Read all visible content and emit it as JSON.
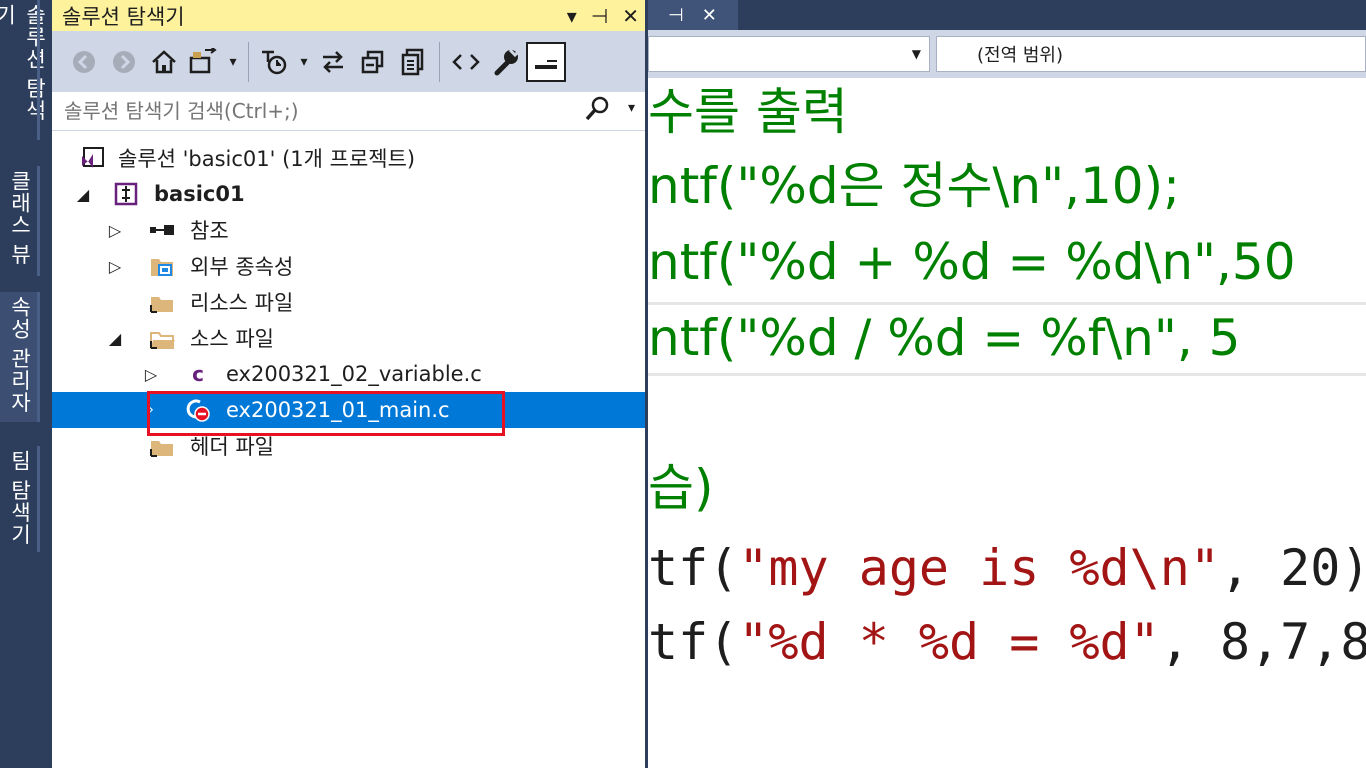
{
  "side_tabs": [
    {
      "label": "솔루션 탐색기",
      "active": false
    },
    {
      "label": "클래스 뷰",
      "active": false
    },
    {
      "label": "속성 관리자",
      "active": true
    },
    {
      "label": "팀 탐색기",
      "active": false
    }
  ],
  "panel": {
    "title": "솔루션 탐색기",
    "controls": {
      "dropdown": "▾",
      "pin": "⊣",
      "close": "✕"
    },
    "search_placeholder": "솔루션 탐색기 검색(Ctrl+;)"
  },
  "tree": {
    "solution": "솔루션 'basic01' (1개 프로젝트)",
    "project": "basic01",
    "items": [
      {
        "label": "참조",
        "icon": "references-icon"
      },
      {
        "label": "외부 종속성",
        "icon": "external-dependencies-icon"
      },
      {
        "label": "리소스 파일",
        "icon": "folder-icon"
      },
      {
        "label": "소스 파일",
        "icon": "folder-open-icon"
      },
      {
        "label": "ex200321_02_variable.c",
        "icon": "c-file-icon"
      },
      {
        "label": "ex200321_01_main.c",
        "icon": "c-file-excluded-icon",
        "selected": true
      },
      {
        "label": "헤더 파일",
        "icon": "folder-icon"
      }
    ]
  },
  "editor": {
    "tab_pin": "⊣",
    "tab_close": "✕",
    "scope_dropdown": "(전역 범위)",
    "lines": [
      {
        "parts": [
          {
            "t": "수를 출력",
            "c": "cmt"
          }
        ]
      },
      {
        "parts": [
          {
            "t": "ntf(\"%d은 정수\\n\",10);",
            "c": "cmt"
          }
        ]
      },
      {
        "parts": [
          {
            "t": "ntf(\"%d + %d = %d\\n\",50",
            "c": "cmt"
          }
        ]
      },
      {
        "parts": [
          {
            "t": "ntf(\"%d / %d = %f\\n\", 5",
            "c": "cmt"
          }
        ]
      },
      {
        "parts": [
          {
            "t": "",
            "c": "blk"
          }
        ]
      },
      {
        "parts": [
          {
            "t": "습)",
            "c": "cmt"
          }
        ]
      },
      {
        "parts": [
          {
            "t": "tf(",
            "c": "blk"
          },
          {
            "t": "\"my age is %d\\n\"",
            "c": "str"
          },
          {
            "t": ", 20)",
            "c": "blk"
          }
        ]
      },
      {
        "parts": [
          {
            "t": "tf(",
            "c": "blk"
          },
          {
            "t": "\"%d * %d = %d\"",
            "c": "str"
          },
          {
            "t": ", 8,7,8",
            "c": "blk"
          }
        ]
      }
    ]
  },
  "colors": {
    "selection": "#0078d7",
    "title_active": "#fff29d",
    "highlight_box": "#e81123",
    "comment": "#008000",
    "string": "#a31515"
  }
}
